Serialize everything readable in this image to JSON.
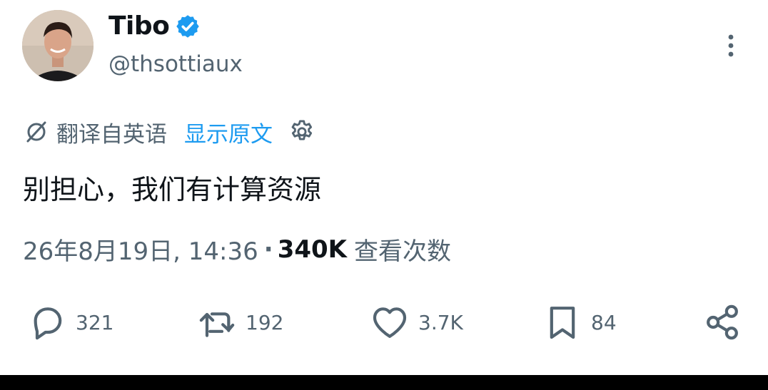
{
  "author": {
    "name": "Tibo",
    "handle": "@thsottiaux",
    "verified": true
  },
  "translation": {
    "icon": "translate-icon",
    "translated_from": "翻译自英语",
    "show_original": "显示原文",
    "settings_icon": "gear-icon"
  },
  "tweet": {
    "text": "别担心，我们有计算资源"
  },
  "meta": {
    "timestamp": "26年8月19日, 14:36",
    "separator": "·",
    "views_count": "340K",
    "views_label": "查看次数"
  },
  "actions": {
    "replies": "321",
    "reposts": "192",
    "likes": "3.7K",
    "bookmarks": "84"
  },
  "colors": {
    "accent": "#1d9bf0",
    "secondary_text": "#536471",
    "primary_text": "#0f1419"
  }
}
